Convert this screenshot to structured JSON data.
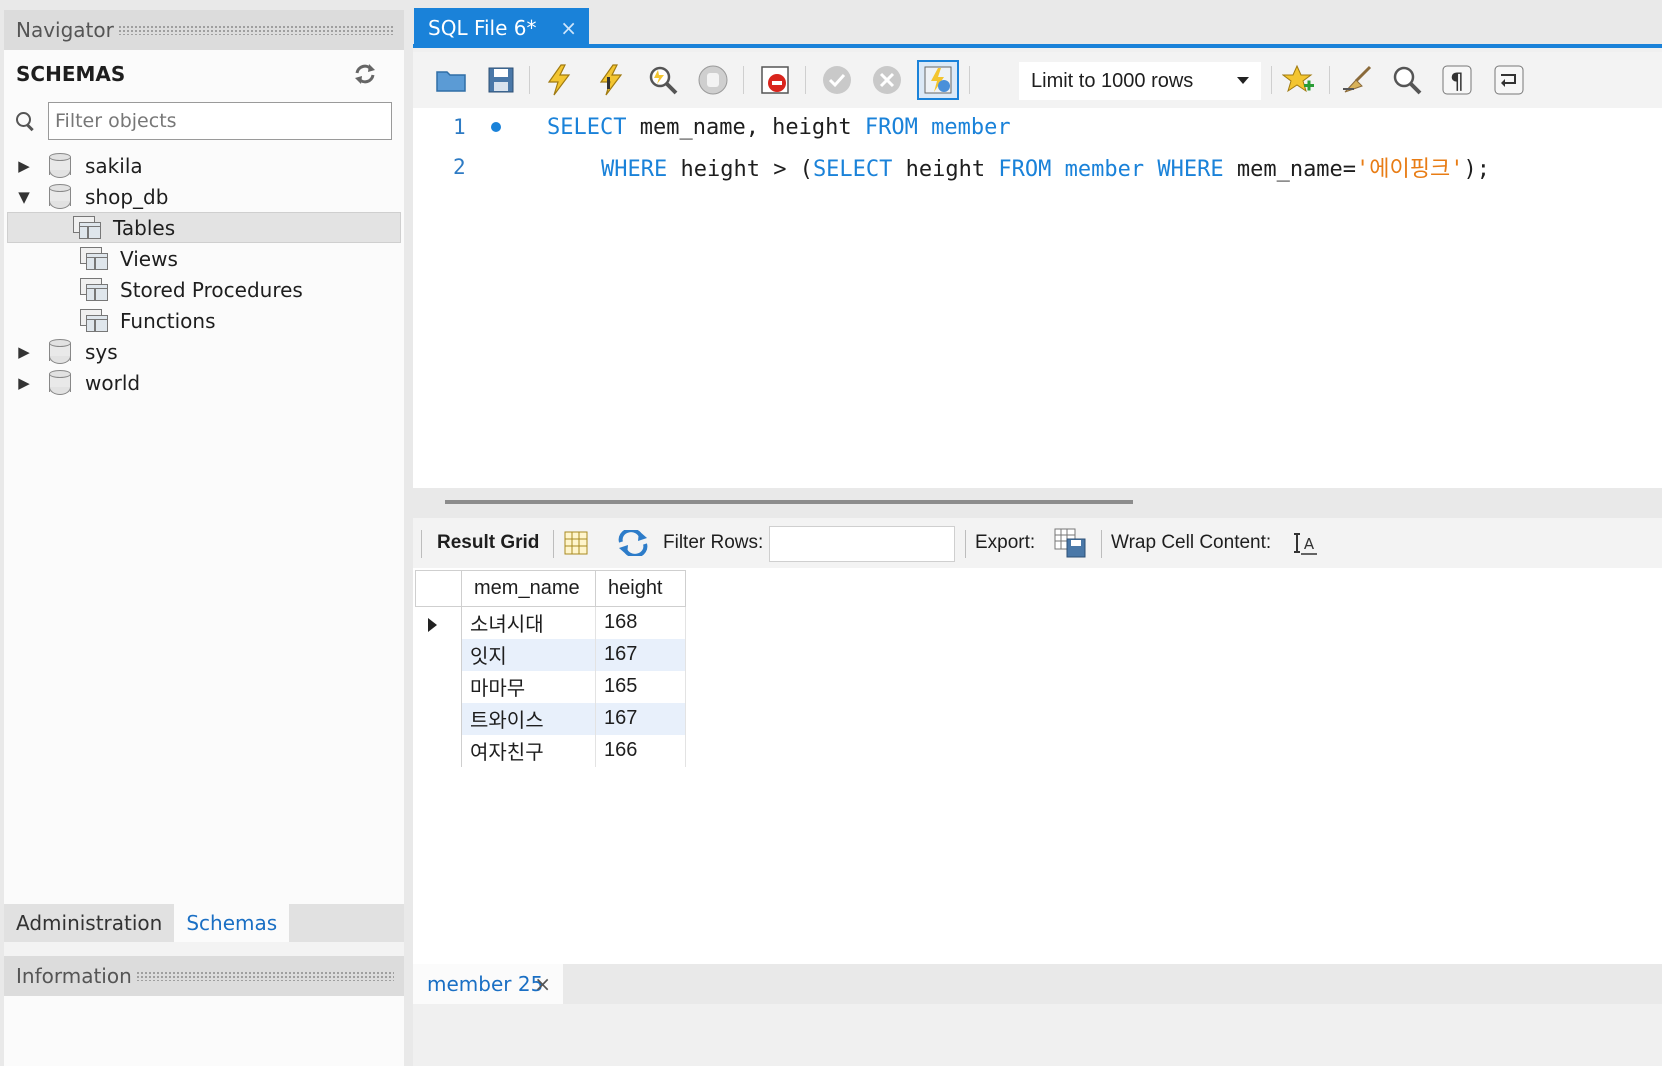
{
  "navigator": {
    "title": "Navigator",
    "schemas_label": "SCHEMAS",
    "filter_placeholder": "Filter objects",
    "tree": [
      {
        "label": "sakila",
        "expanded": false
      },
      {
        "label": "shop_db",
        "expanded": true,
        "children": [
          "Tables",
          "Views",
          "Stored Procedures",
          "Functions"
        ]
      },
      {
        "label": "sys",
        "expanded": false
      },
      {
        "label": "world",
        "expanded": false
      }
    ],
    "bottom_tabs": [
      "Administration",
      "Schemas"
    ],
    "information_title": "Information"
  },
  "editor": {
    "tab_label": "SQL File 6*",
    "limit_label": "Limit to 1000 rows",
    "line_numbers": [
      "1",
      "2"
    ]
  },
  "result": {
    "result_grid_label": "Result Grid",
    "filter_rows_label": "Filter Rows:",
    "export_label": "Export:",
    "wrap_label": "Wrap Cell Content:",
    "columns": [
      "mem_name",
      "height"
    ],
    "rows": [
      [
        "소녀시대",
        "168"
      ],
      [
        "잇지",
        "167"
      ],
      [
        "마마무",
        "165"
      ],
      [
        "트와이스",
        "167"
      ],
      [
        "여자친구",
        "166"
      ]
    ],
    "tab_label": "member 25"
  },
  "colors": {
    "accent": "#1a82d9",
    "keyword": "#1a82d9",
    "string": "#e87c14"
  }
}
